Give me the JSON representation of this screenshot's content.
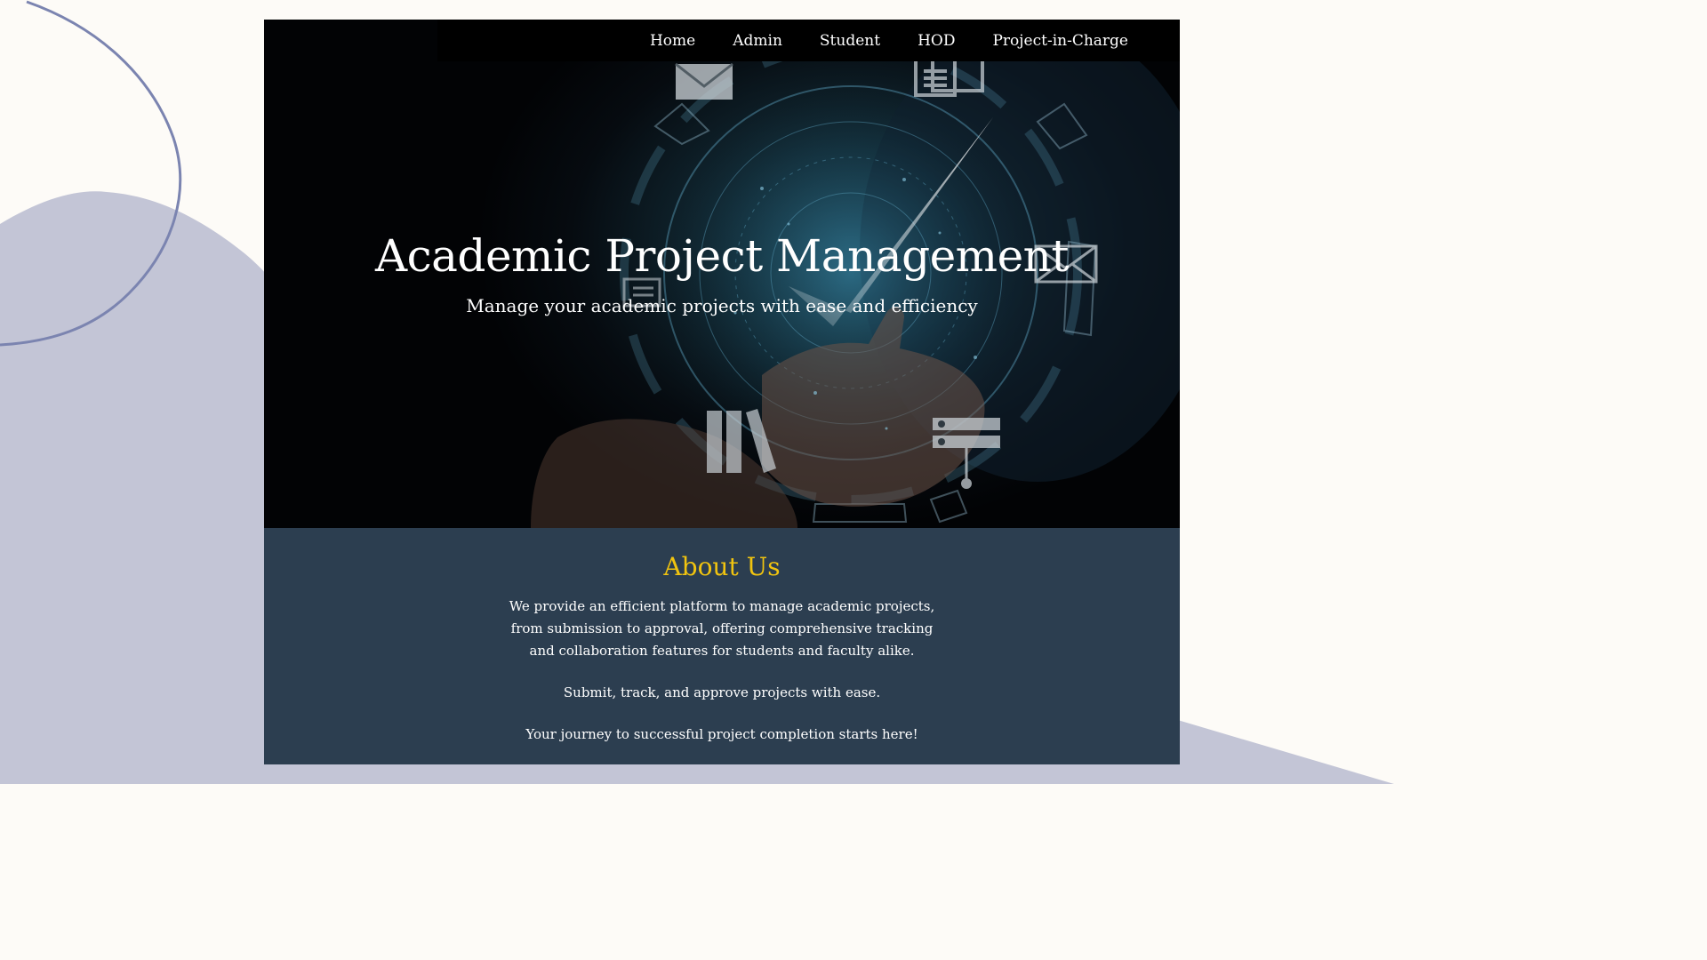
{
  "colors": {
    "page_background": "#fdfbf7",
    "decor_blob": "#c3c5d6",
    "decor_ring": "#7b84b0",
    "navbar_background": "#000000",
    "about_background": "#2c3e50",
    "about_heading": "#f1c40f",
    "text": "#ffffff"
  },
  "nav": {
    "items": [
      {
        "label": "Home"
      },
      {
        "label": "Admin"
      },
      {
        "label": "Student"
      },
      {
        "label": "HOD"
      },
      {
        "label": "Project-in-Charge"
      }
    ]
  },
  "hero": {
    "title": "Academic Project Management",
    "subtitle": "Manage your academic projects with ease and efficiency",
    "image_icons": [
      "envelope-icon",
      "document-icon",
      "checkmark-icon",
      "list-icon",
      "binders-icon",
      "server-icon",
      "envelope-icon"
    ]
  },
  "about": {
    "heading": "About Us",
    "description": "We provide an efficient platform to manage academic projects, from submission to approval, offering comprehensive tracking and collaboration features for students and faculty alike.",
    "line1": "Submit, track, and approve projects with ease.",
    "line2": "Your journey to successful project completion starts here!"
  }
}
